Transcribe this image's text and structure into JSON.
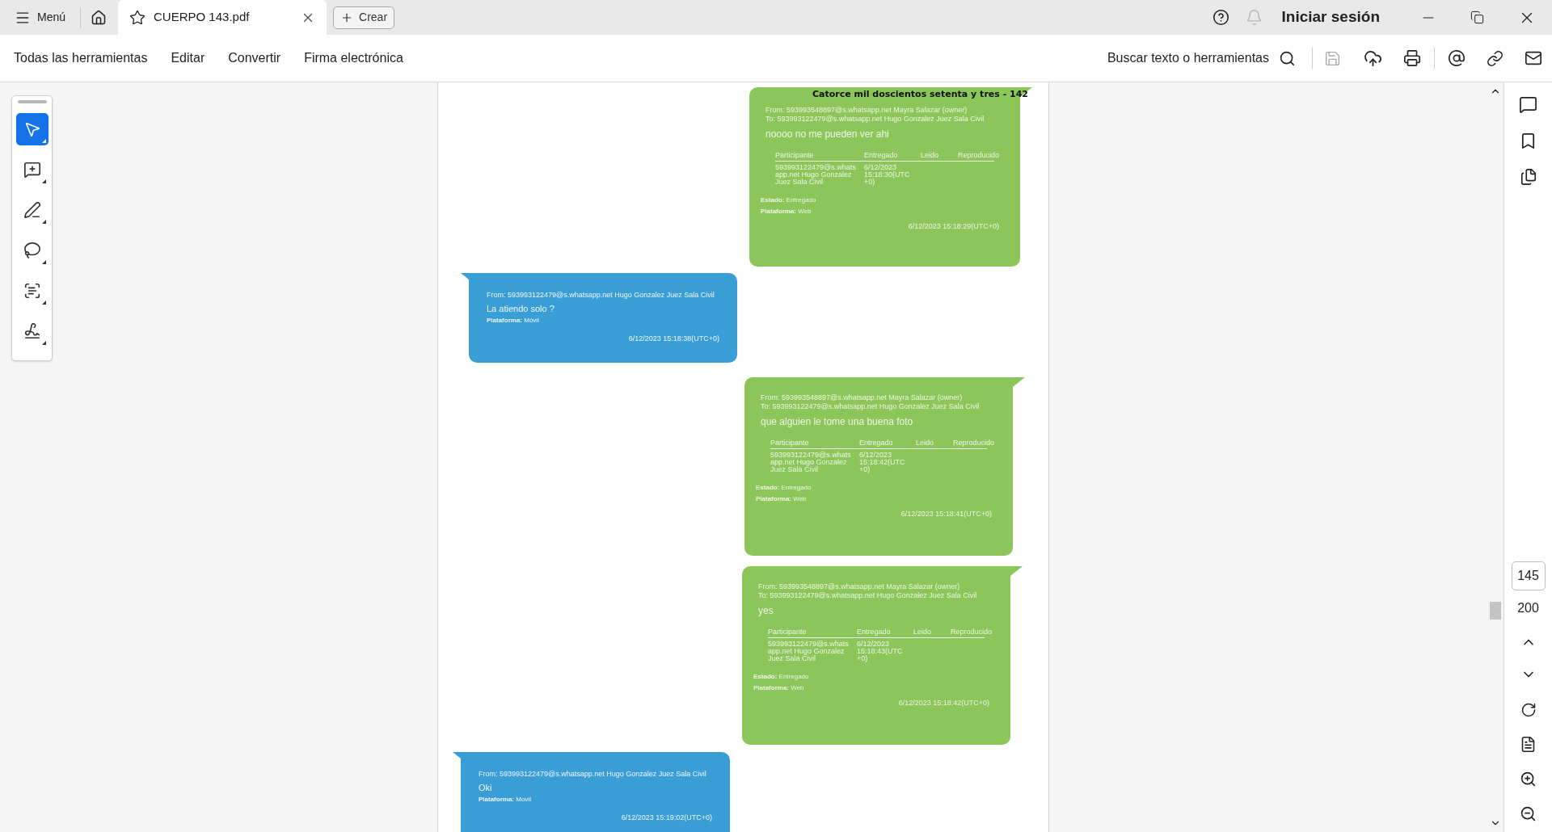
{
  "menu_button": "Menú",
  "tab": {
    "title": "CUERPO 143.pdf"
  },
  "create_button": "Crear",
  "sign_in": "Iniciar sesión",
  "toolbar": {
    "items": [
      "Todas las herramientas",
      "Editar",
      "Convertir",
      "Firma electrónica"
    ],
    "search_label": "Buscar texto o herramientas"
  },
  "tools": [
    {
      "selected": true
    },
    {
      "selected": false
    },
    {
      "selected": false
    },
    {
      "selected": false
    },
    {
      "selected": false
    },
    {
      "selected": false
    }
  ],
  "document": {
    "page_header": "Catorce mil doscientos setenta y tres - 142",
    "messages": [
      {
        "kind": "sent",
        "from": "From: 593993548897@s.whatsapp.net Mayra Salazar (owner)",
        "to": "To: 593993122479@s.whatsapp.net Hugo Gonzalez Juez Sala Civil",
        "text": "noooo no me pueden ver ahi",
        "columns": [
          "Participante",
          "Entregado",
          "Leido",
          "Reproducido"
        ],
        "row": [
          "593993122479@s.whatsapp.net Hugo Gonzalez Juez Sala Civil",
          "6/12/2023 15:18:30(UTC+0)"
        ],
        "status": "**Estado:** Entregado",
        "platform": "**Plataforma:** Web",
        "time": "6/12/2023 15:18:29(UTC+0)"
      },
      {
        "kind": "received",
        "from": "From: 593993122479@s.whatsapp.net Hugo Gonzalez Juez Sala Civil",
        "text": "La atiendo solo ?",
        "platform": "**Plataforma:** Móvil",
        "time": "6/12/2023 15:18:38(UTC+0)"
      },
      {
        "kind": "sent",
        "from": "From: 593993548897@s.whatsapp.net Mayra Salazar (owner)",
        "to": "To: 593993122479@s.whatsapp.net Hugo Gonzalez Juez Sala Civil",
        "text": "que alguien le tome una buena foto",
        "columns": [
          "Participante",
          "Entregado",
          "Leido",
          "Reproducido"
        ],
        "row": [
          "593993122479@s.whatsapp.net Hugo Gonzalez Juez Sala Civil",
          "6/12/2023 15:18:42(UTC+0)"
        ],
        "status": "**Estado:** Entregado",
        "platform": "**Plataforma:** Web",
        "time": "6/12/2023 15:18:41(UTC+0)"
      },
      {
        "kind": "sent",
        "from": "From: 593993548897@s.whatsapp.net Mayra Salazar (owner)",
        "to": "To: 593993122479@s.whatsapp.net Hugo Gonzalez Juez Sala Civil",
        "text": "yes",
        "columns": [
          "Participante",
          "Entregado",
          "Leido",
          "Reproducido"
        ],
        "row": [
          "593993122479@s.whatsapp.net Hugo Gonzalez Juez Sala Civil",
          "6/12/2023 15:18:43(UTC+0)"
        ],
        "status": "**Estado:** Entregado",
        "platform": "**Plataforma:** Web",
        "time": "6/12/2023 15:18:42(UTC+0)"
      },
      {
        "kind": "received",
        "from": "From: 593993122479@s.whatsapp.net Hugo Gonzalez Juez Sala Civil",
        "text": "Oki",
        "platform": "**Plataforma:** Movil",
        "time": "6/12/2023 15:19:02(UTC+0)"
      }
    ]
  },
  "page_nav": {
    "current": "145",
    "total": "200"
  }
}
